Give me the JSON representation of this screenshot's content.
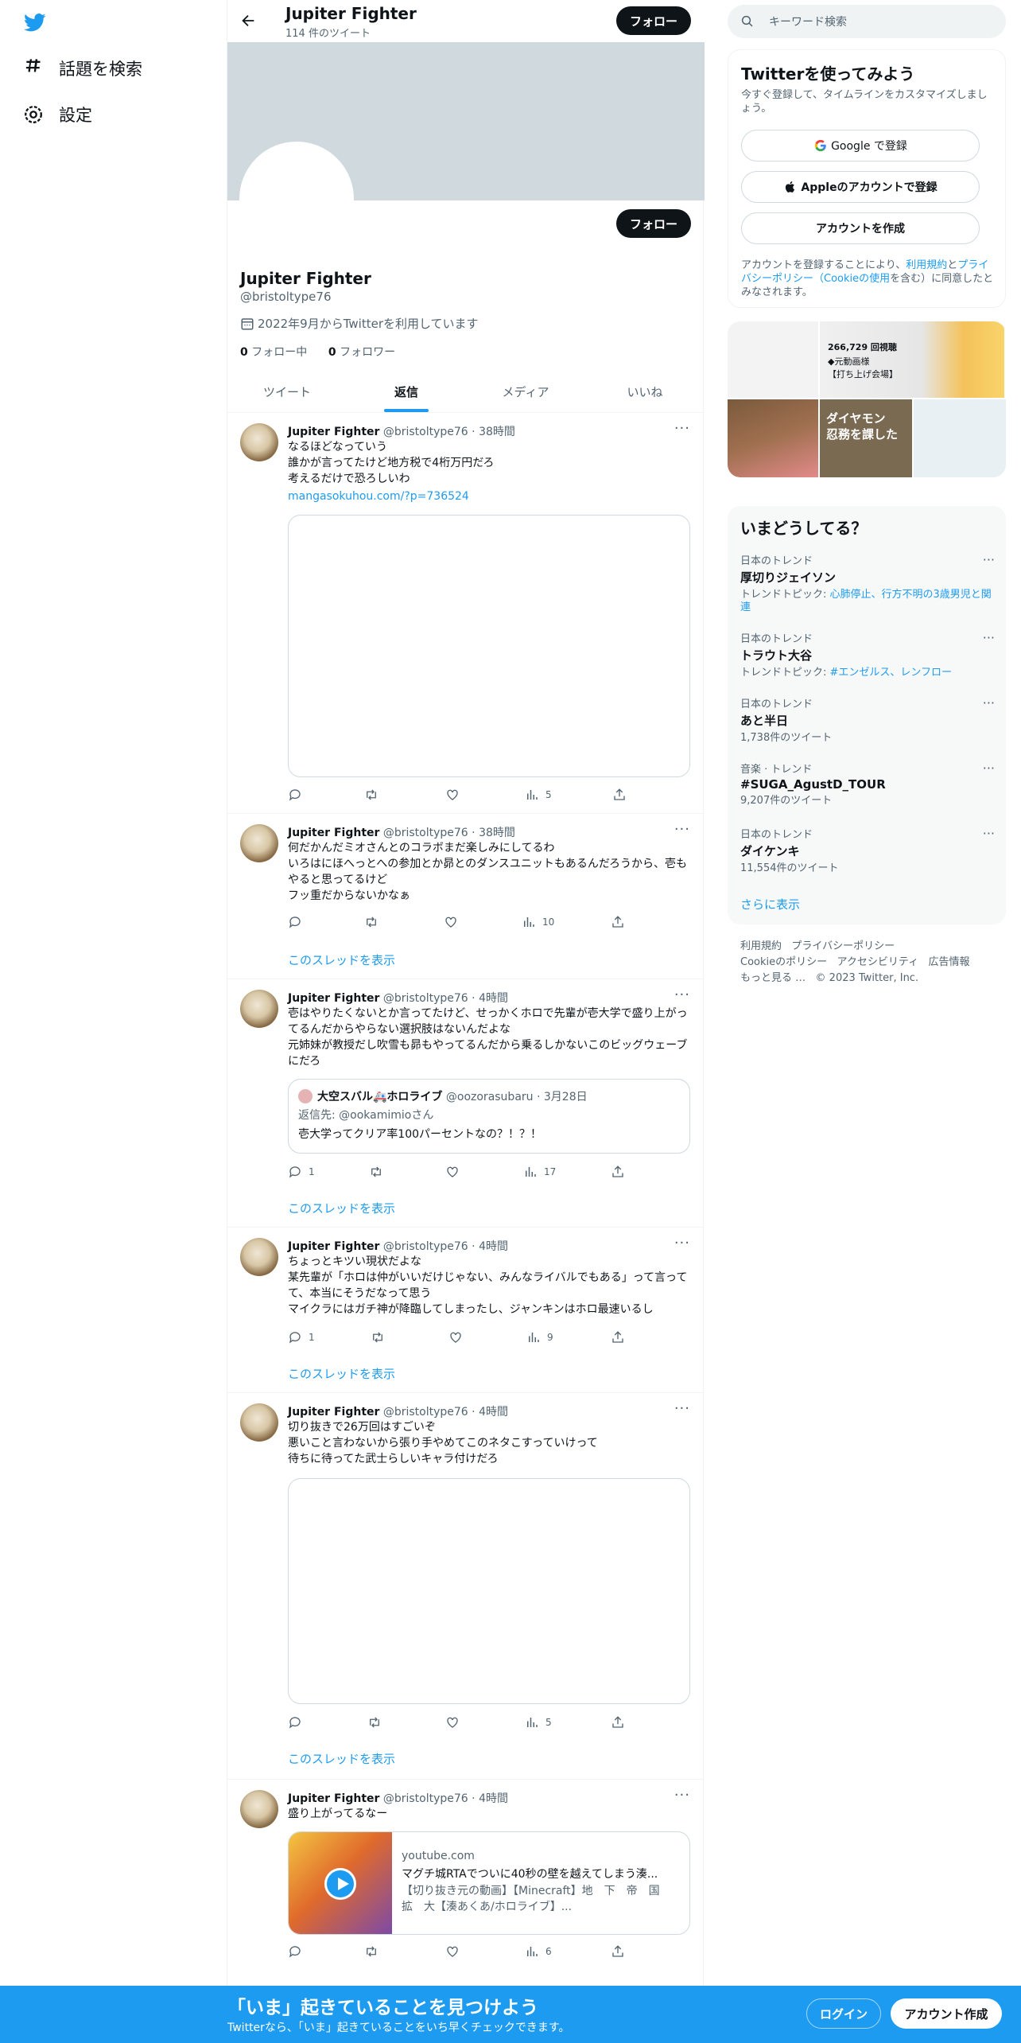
{
  "nav": {
    "items": [
      {
        "label": "話題を検索",
        "icon": "hashtag-icon"
      },
      {
        "label": "設定",
        "icon": "gear-icon"
      }
    ]
  },
  "header": {
    "name": "Jupiter Fighter",
    "tweet_count": "114 件のツイート",
    "follow_label": "フォロー"
  },
  "profile": {
    "name": "Jupiter Fighter",
    "handle": "@bristoltype76",
    "joined": "2022年9月からTwitterを利用しています",
    "following_count": "0",
    "following_label": " フォロー中",
    "followers_count": "0",
    "followers_label": " フォロワー",
    "follow_label": "フォロー"
  },
  "tabs": [
    {
      "label": "ツイート",
      "active": false
    },
    {
      "label": "返信",
      "active": true
    },
    {
      "label": "メディア",
      "active": false
    },
    {
      "label": "いいね",
      "active": false
    }
  ],
  "tweets": [
    {
      "name": "Jupiter Fighter",
      "meta": " @bristoltype76 · 38時間",
      "text": "なるほどなっていう\n誰かが言ってたけど地方税で4桁万円だろ\n考えるだけで恐ろしいわ",
      "link": "mangasokuhou.com/?p=736524",
      "reply": "",
      "retweet": "",
      "like": "",
      "views": "5"
    },
    {
      "name": "Jupiter Fighter",
      "meta": " @bristoltype76 · 38時間",
      "text": "何だかんだミオさんとのコラボまだ楽しみにしてるわ\nいろはにほへっとへの参加とか昴とのダンスユニットもあるんだろうから、壱もやると思ってるけど\nフッ重だからないかなぁ",
      "reply": "",
      "retweet": "",
      "like": "",
      "views": "10",
      "thread": "このスレッドを表示"
    },
    {
      "name": "Jupiter Fighter",
      "meta": " @bristoltype76 · 4時間",
      "text": "壱はやりたくないとか言ってたけど、せっかくホロで先輩が壱大学で盛り上がってるんだからやらない選択肢はないんだよな\n元姉妹が教授だし吹雪も昴もやってるんだから乗るしかないこのビッグウェーブにだろ",
      "quote": {
        "name": "大空スバル🚑ホロライブ",
        "meta": " @oozorasubaru · 3月28日",
        "reply_to": "返信先: @ookamimioさん",
        "text": "壱大学ってクリア率100パーセントなの？！？！"
      },
      "reply": "1",
      "retweet": "",
      "like": "",
      "views": "17",
      "thread": "このスレッドを表示"
    },
    {
      "name": "Jupiter Fighter",
      "meta": " @bristoltype76 · 4時間",
      "text": "ちょっとキツい現状だよな\n某先輩が「ホロは仲がいいだけじゃない、みんなライバルでもある」って言ってて、本当にそうだなって思う\nマイクラにはガチ神が降臨してしまったし、ジャンキンはホロ最速いるし",
      "reply": "1",
      "retweet": "",
      "like": "",
      "views": "9",
      "thread": "このスレッドを表示"
    },
    {
      "name": "Jupiter Fighter",
      "meta": " @bristoltype76 · 4時間",
      "text": "切り抜きで26万回はすごいぞ\n悪いこと言わないから張り手やめてこのネタこすっていけって\n待ちに待ってた武士らしいキャラ付けだろ",
      "reply": "",
      "retweet": "",
      "like": "",
      "views": "5",
      "thread": "このスレッドを表示"
    },
    {
      "name": "Jupiter Fighter",
      "meta": " @bristoltype76 · 4時間",
      "text": "盛り上がってるなー",
      "card": {
        "domain": "youtube.com",
        "title": "マグチ城RTAでついに40秒の壁を越えてしまう湊...",
        "desc": "【切り抜き元の動画】【Minecraft】地　下　帝　国　拡　大【湊あくあ/ホロライブ】..."
      },
      "reply": "",
      "retweet": "",
      "like": "",
      "views": "6"
    }
  ],
  "search": {
    "placeholder": "キーワード検索"
  },
  "signup": {
    "title": "Twitterを使ってみよう",
    "subtitle": "今すぐ登録して、タイムラインをカスタマイズしましょう。",
    "google": "Google で登録",
    "apple": "Appleのアカウントで登録",
    "create": "アカウントを作成",
    "legal_pre": "アカウントを登録することにより、",
    "legal_tos": "利用規約",
    "legal_and": "と",
    "legal_privacy": "プライバシーポリシー（Cookieの使用",
    "legal_post": "を含む）に同意したとみなされます。"
  },
  "trends": {
    "title": "いまどうしてる？",
    "items": [
      {
        "context": "日本のトレンド",
        "name": "厚切りジェイソン",
        "meta_label": "トレンドトピック: ",
        "meta_link": "心肺停止、行方不明の3歳男児と関連"
      },
      {
        "context": "日本のトレンド",
        "name": "トラウト大谷",
        "meta_label": "トレンドトピック: ",
        "meta_link": "#エンゼルス、レンフロー"
      },
      {
        "context": "日本のトレンド",
        "name": "あと半日",
        "meta_label": "1,738件のツイート",
        "meta_link": ""
      },
      {
        "context": "音楽 · トレンド",
        "name": "#SUGA_AgustD_TOUR",
        "meta_label": "9,207件のツイート",
        "meta_link": ""
      },
      {
        "context": "日本のトレンド",
        "name": "ダイケンキ",
        "meta_label": "11,554件のツイート",
        "meta_link": ""
      }
    ],
    "show_more": "さらに表示"
  },
  "media_texts": {
    "views": "266,729 回視聴",
    "line1": "◆元動画様",
    "line2": "【打ち上げ会場】",
    "caption": "ダイヤモン\n忍務を課した"
  },
  "footer": {
    "row1": [
      "利用規約",
      "プライバシーポリシー"
    ],
    "row2": [
      "Cookieのポリシー",
      "アクセシビリティ",
      "広告情報"
    ],
    "row3": [
      "もっと見る …",
      "© 2023 Twitter, Inc."
    ]
  },
  "bottom_bar": {
    "title": "「いま」起きていることを見つけよう",
    "subtitle": "Twitterなら、「いま」起きていることをいち早くチェックできます。",
    "login": "ログイン",
    "signup": "アカウント作成"
  },
  "colors": {
    "accent": "#1d9bf0",
    "text": "#0f1419",
    "muted": "#536471",
    "banner": "#cfd9de"
  }
}
